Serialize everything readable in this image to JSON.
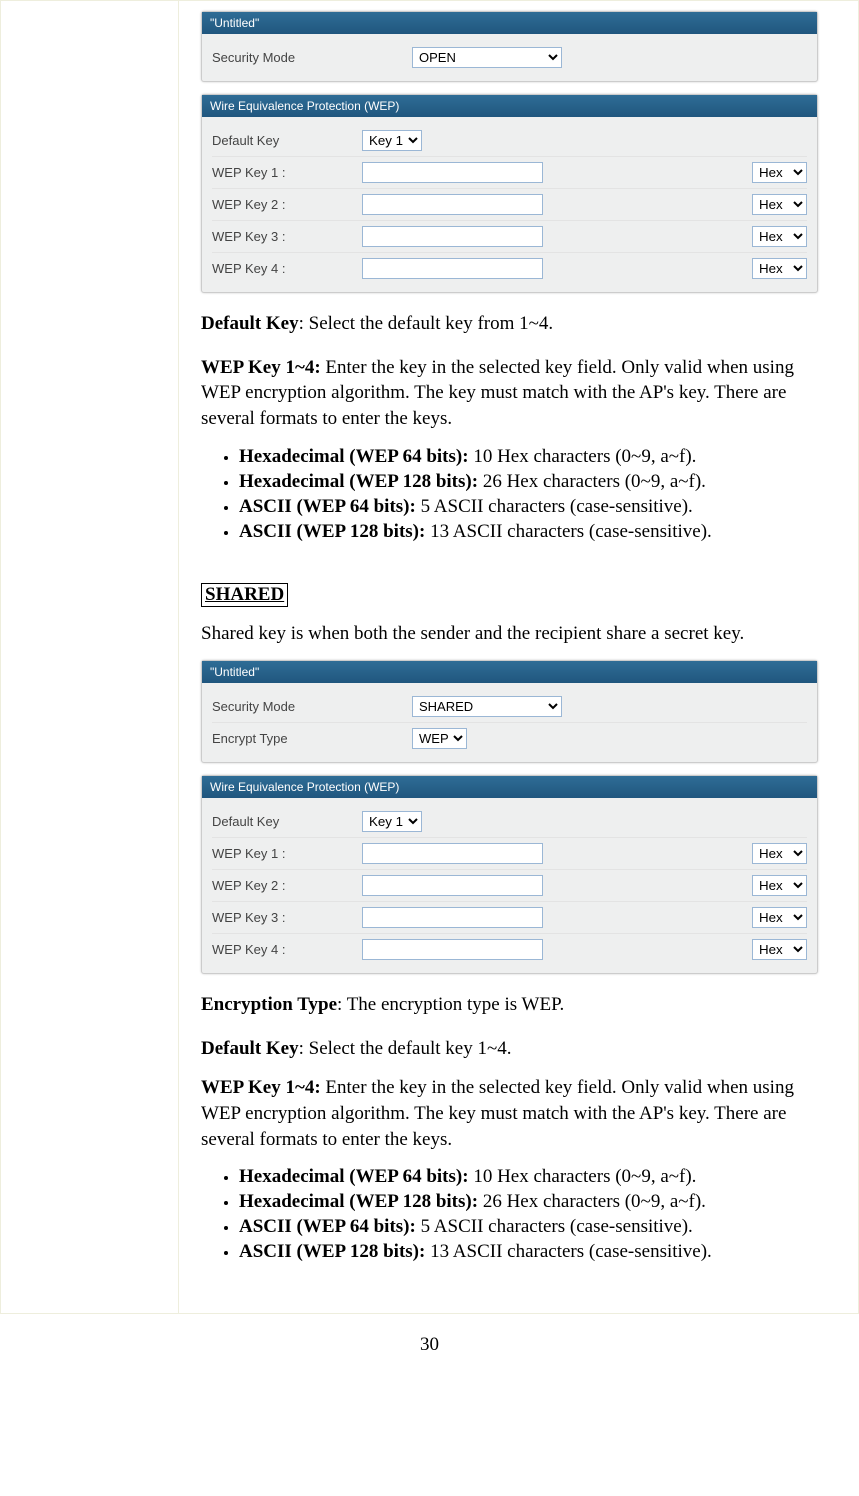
{
  "panel1": {
    "header": "\"Untitled\"",
    "security_mode_label": "Security Mode",
    "security_mode_value": "OPEN"
  },
  "wep_header": "Wire Equivalence Protection (WEP)",
  "wep_open": {
    "default_key_label": "Default Key",
    "default_key_value": "Key 1",
    "rows": [
      {
        "label": "WEP Key 1 :",
        "value": "",
        "fmt": "Hex"
      },
      {
        "label": "WEP Key 2 :",
        "value": "",
        "fmt": "Hex"
      },
      {
        "label": "WEP Key 3 :",
        "value": "",
        "fmt": "Hex"
      },
      {
        "label": "WEP Key 4 :",
        "value": "",
        "fmt": "Hex"
      }
    ]
  },
  "text_defaultkey_1_b": "Default Key",
  "text_defaultkey_1": ": Select the default key from 1~4.",
  "text_wepkey_1_b": "WEP Key 1~4:",
  "text_wepkey_1": " Enter the key in the selected key field. Only valid when using WEP encryption algorithm. The key must match with the AP's key. There are several formats to enter the keys.",
  "bullets1": [
    {
      "b": "Hexadecimal (WEP 64 bits):",
      "t": " 10 Hex characters (0~9, a~f)."
    },
    {
      "b": "Hexadecimal (WEP 128 bits):",
      "t": " 26 Hex characters (0~9, a~f)."
    },
    {
      "b": "ASCII (WEP 64 bits):",
      "t": " 5 ASCII characters (case-sensitive)."
    },
    {
      "b": "ASCII (WEP 128 bits):",
      "t": " 13 ASCII characters (case-sensitive)."
    }
  ],
  "shared_heading": "SHARED",
  "shared_intro": "Shared key is when both the sender and the recipient share a secret key.",
  "panel2": {
    "header": "\"Untitled\"",
    "security_mode_label": "Security Mode",
    "security_mode_value": "SHARED",
    "encrypt_type_label": "Encrypt Type",
    "encrypt_type_value": "WEP"
  },
  "wep_shared": {
    "default_key_label": "Default Key",
    "default_key_value": "Key 1",
    "rows": [
      {
        "label": "WEP Key 1 :",
        "value": "",
        "fmt": "Hex"
      },
      {
        "label": "WEP Key 2 :",
        "value": "",
        "fmt": "Hex"
      },
      {
        "label": "WEP Key 3 :",
        "value": "",
        "fmt": "Hex"
      },
      {
        "label": "WEP Key 4 :",
        "value": "",
        "fmt": "Hex"
      }
    ]
  },
  "text_encryption_b": "Encryption Type",
  "text_encryption": ": The encryption type is WEP.",
  "text_defaultkey_2_b": "Default Key",
  "text_defaultkey_2": ": Select the default key 1~4.",
  "text_wepkey_2_b": "WEP Key 1~4:",
  "text_wepkey_2": " Enter the key in the selected key field. Only valid when using WEP encryption algorithm. The key must match with the AP's key. There are several formats to enter the keys.",
  "bullets2": [
    {
      "b": "Hexadecimal (WEP 64 bits):",
      "t": " 10 Hex characters (0~9, a~f)."
    },
    {
      "b": "Hexadecimal (WEP 128 bits):",
      "t": " 26 Hex characters (0~9, a~f)."
    },
    {
      "b": "ASCII (WEP 64 bits):",
      "t": " 5 ASCII characters (case-sensitive)."
    },
    {
      "b": "ASCII (WEP 128 bits):",
      "t": " 13 ASCII characters (case-sensitive)."
    }
  ],
  "page_number": "30"
}
